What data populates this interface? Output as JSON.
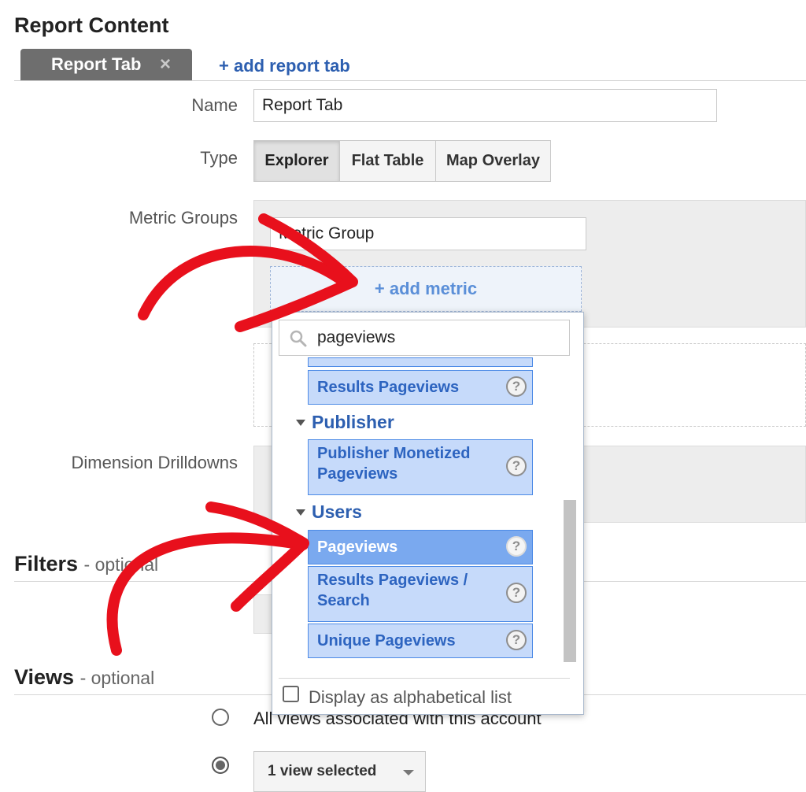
{
  "report_content": {
    "title": "Report Content"
  },
  "tabs": {
    "active_tab_label": "Report Tab",
    "close_glyph": "×",
    "add_tab_label": "+ add report tab"
  },
  "form": {
    "name_label": "Name",
    "name_value": "Report Tab",
    "type_label": "Type",
    "type_options": [
      "Explorer",
      "Flat Table",
      "Map Overlay"
    ],
    "type_selected": "Explorer",
    "metric_groups_label": "Metric Groups",
    "metric_group_value": "Metric Group",
    "add_metric_label": "+ add metric",
    "dimension_drilldowns_label": "Dimension Drilldowns"
  },
  "metric_picker": {
    "search_value": "pageviews",
    "search_icon": "search-icon",
    "partial_item": "Results Pageviews",
    "categories": [
      {
        "name": "Publisher",
        "items": [
          "Publisher Monetized Pageviews"
        ]
      },
      {
        "name": "Users",
        "items": [
          "Pageviews",
          "Results Pageviews / Search",
          "Unique Pageviews"
        ]
      }
    ],
    "selected_item": "Pageviews",
    "help_glyph": "?",
    "alphabetical_label": "Display as alphabetical list"
  },
  "filters": {
    "title": "Filters",
    "optional": "- optional"
  },
  "views": {
    "title": "Views",
    "optional": "- optional",
    "all_views_label": "All views associated with this account",
    "view_select_value": "1 view selected"
  },
  "colors": {
    "link": "#2d5fb0",
    "item_bg": "#c6dafa",
    "item_selected_bg": "#7aa9ef",
    "annotation_arrow": "#e8101c"
  }
}
